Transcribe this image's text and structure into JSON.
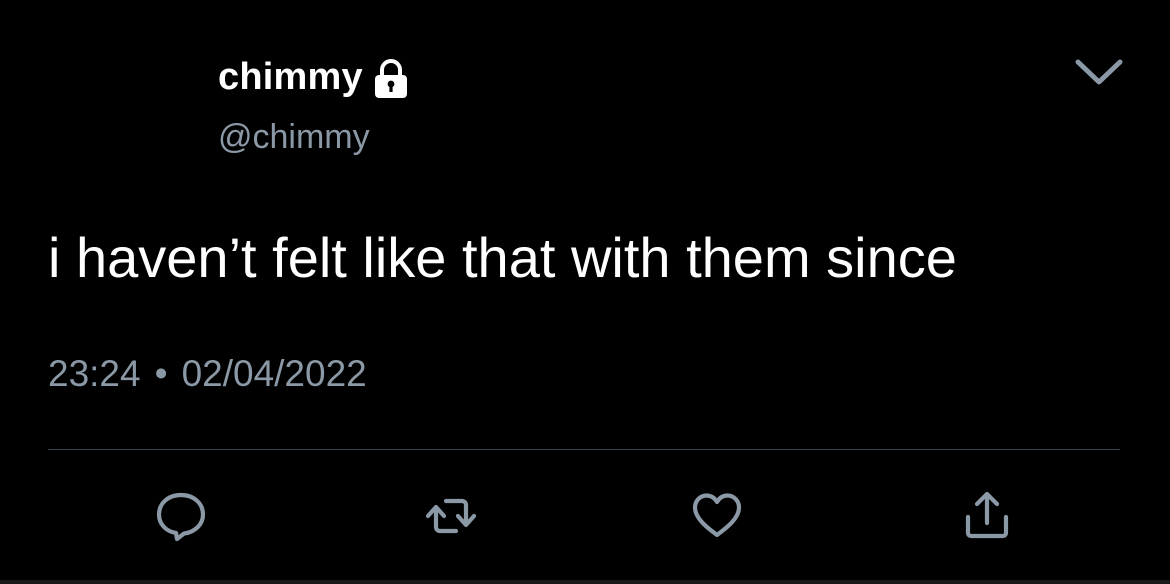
{
  "tweet": {
    "display_name": "chimmy",
    "handle": "@chimmy",
    "text": "i haven’t felt like that with them since",
    "time": "23:24",
    "separator": "•",
    "date": "02/04/2022"
  },
  "icons": {
    "protected": "lock-icon",
    "menu": "chevron-down-icon",
    "reply": "reply-icon",
    "retweet": "retweet-icon",
    "like": "heart-icon",
    "share": "share-icon"
  },
  "colors": {
    "background": "#000000",
    "primary_text": "#ffffff",
    "secondary_text": "#8b98a5",
    "divider": "#38444d"
  }
}
